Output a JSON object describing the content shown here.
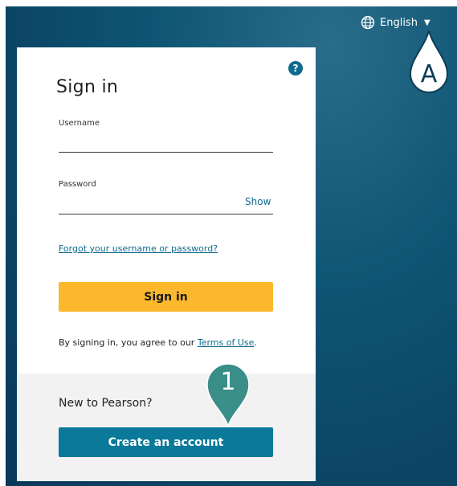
{
  "header": {
    "language": "English",
    "language_icon": "globe-icon",
    "dropdown_icon": "caret-down-icon"
  },
  "annotations": {
    "marker_a": "A",
    "marker_1": "1"
  },
  "signin": {
    "help_icon": "question-icon",
    "help_label": "?",
    "title": "Sign in",
    "username_label": "Username",
    "username_value": "",
    "password_label": "Password",
    "password_value": "",
    "show_label": "Show",
    "forgot_link": "Forgot your username or password?",
    "signin_button": "Sign in",
    "terms_prefix": "By signing in, you agree to our ",
    "terms_link": "Terms of Use",
    "terms_suffix": "."
  },
  "register": {
    "prompt": "New to Pearson?",
    "create_button": "Create an account"
  },
  "colors": {
    "background": "#0b4565",
    "accent": "#0f6a8d",
    "signin_button": "#fbb82c",
    "create_button": "#0b7a9a",
    "marker_1": "#3a8e88"
  }
}
